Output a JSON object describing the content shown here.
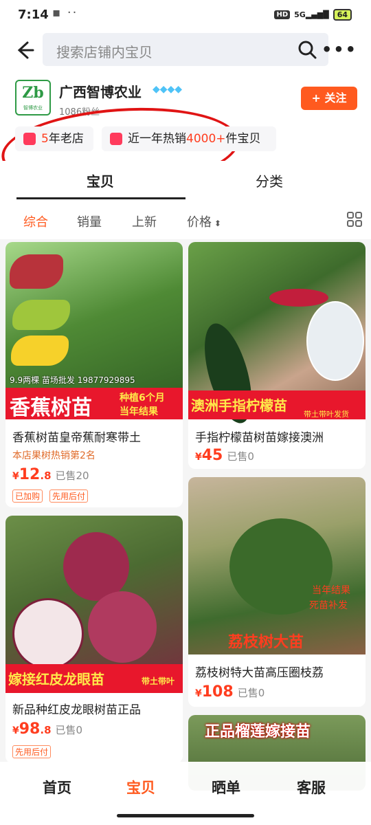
{
  "status": {
    "time": "7:14",
    "network": "5G",
    "battery": "64"
  },
  "search": {
    "placeholder": "搜索店铺内宝贝"
  },
  "shop": {
    "logo_text": "Zb",
    "logo_sub": "智博农业",
    "name": "广西智博农业",
    "fans": "1086粉丝",
    "follow_label": "+ 关注",
    "tag1_highlight": "5",
    "tag1_text": "年老店",
    "tag2_prefix": "近一年热销",
    "tag2_highlight": "4000+",
    "tag2_suffix": "件宝贝"
  },
  "tabs": [
    "宝贝",
    "分类"
  ],
  "filters": [
    "综合",
    "销量",
    "上新",
    "价格"
  ],
  "products": [
    {
      "title": "香蕉树苗皇帝蕉耐寒带土",
      "rank": "本店果树热销第2名",
      "price_int": "12",
      "price_dec": ".8",
      "sold": "已售20",
      "badges": [
        "已加购",
        "先用后付"
      ],
      "img_promo": "9.9两棵 苗场批发 19877929895",
      "img_title": "香蕉树苗",
      "img_sub1": "种植6个月",
      "img_sub2": "当年结果"
    },
    {
      "title": "手指柠檬苗树苗嫁接澳洲",
      "price_int": "45",
      "price_dec": "",
      "sold": "已售0",
      "img_title": "澳洲手指柠檬苗",
      "img_sub1": "带土带叶发货"
    },
    {
      "title": "新品种红皮龙眼树苗正品",
      "price_int": "98",
      "price_dec": ".8",
      "sold": "已售0",
      "badges": [
        "先用后付"
      ],
      "img_title": "嫁接红皮龙眼苗",
      "img_sub1": "带土带叶"
    },
    {
      "title": "荔枝树特大苗高压圈枝荔",
      "price_int": "108",
      "price_dec": "",
      "sold": "已售0",
      "img_title": "荔枝树大苗",
      "img_sub1": "当年结果",
      "img_sub2": "死苗补发"
    },
    {
      "img_title": "正品榴莲嫁接苗"
    }
  ],
  "bottom_nav": [
    "首页",
    "宝贝",
    "晒单",
    "客服"
  ],
  "colors": {
    "accent": "#ff5a1f",
    "price": "#ff3d1f",
    "annotation": "#e01414"
  }
}
